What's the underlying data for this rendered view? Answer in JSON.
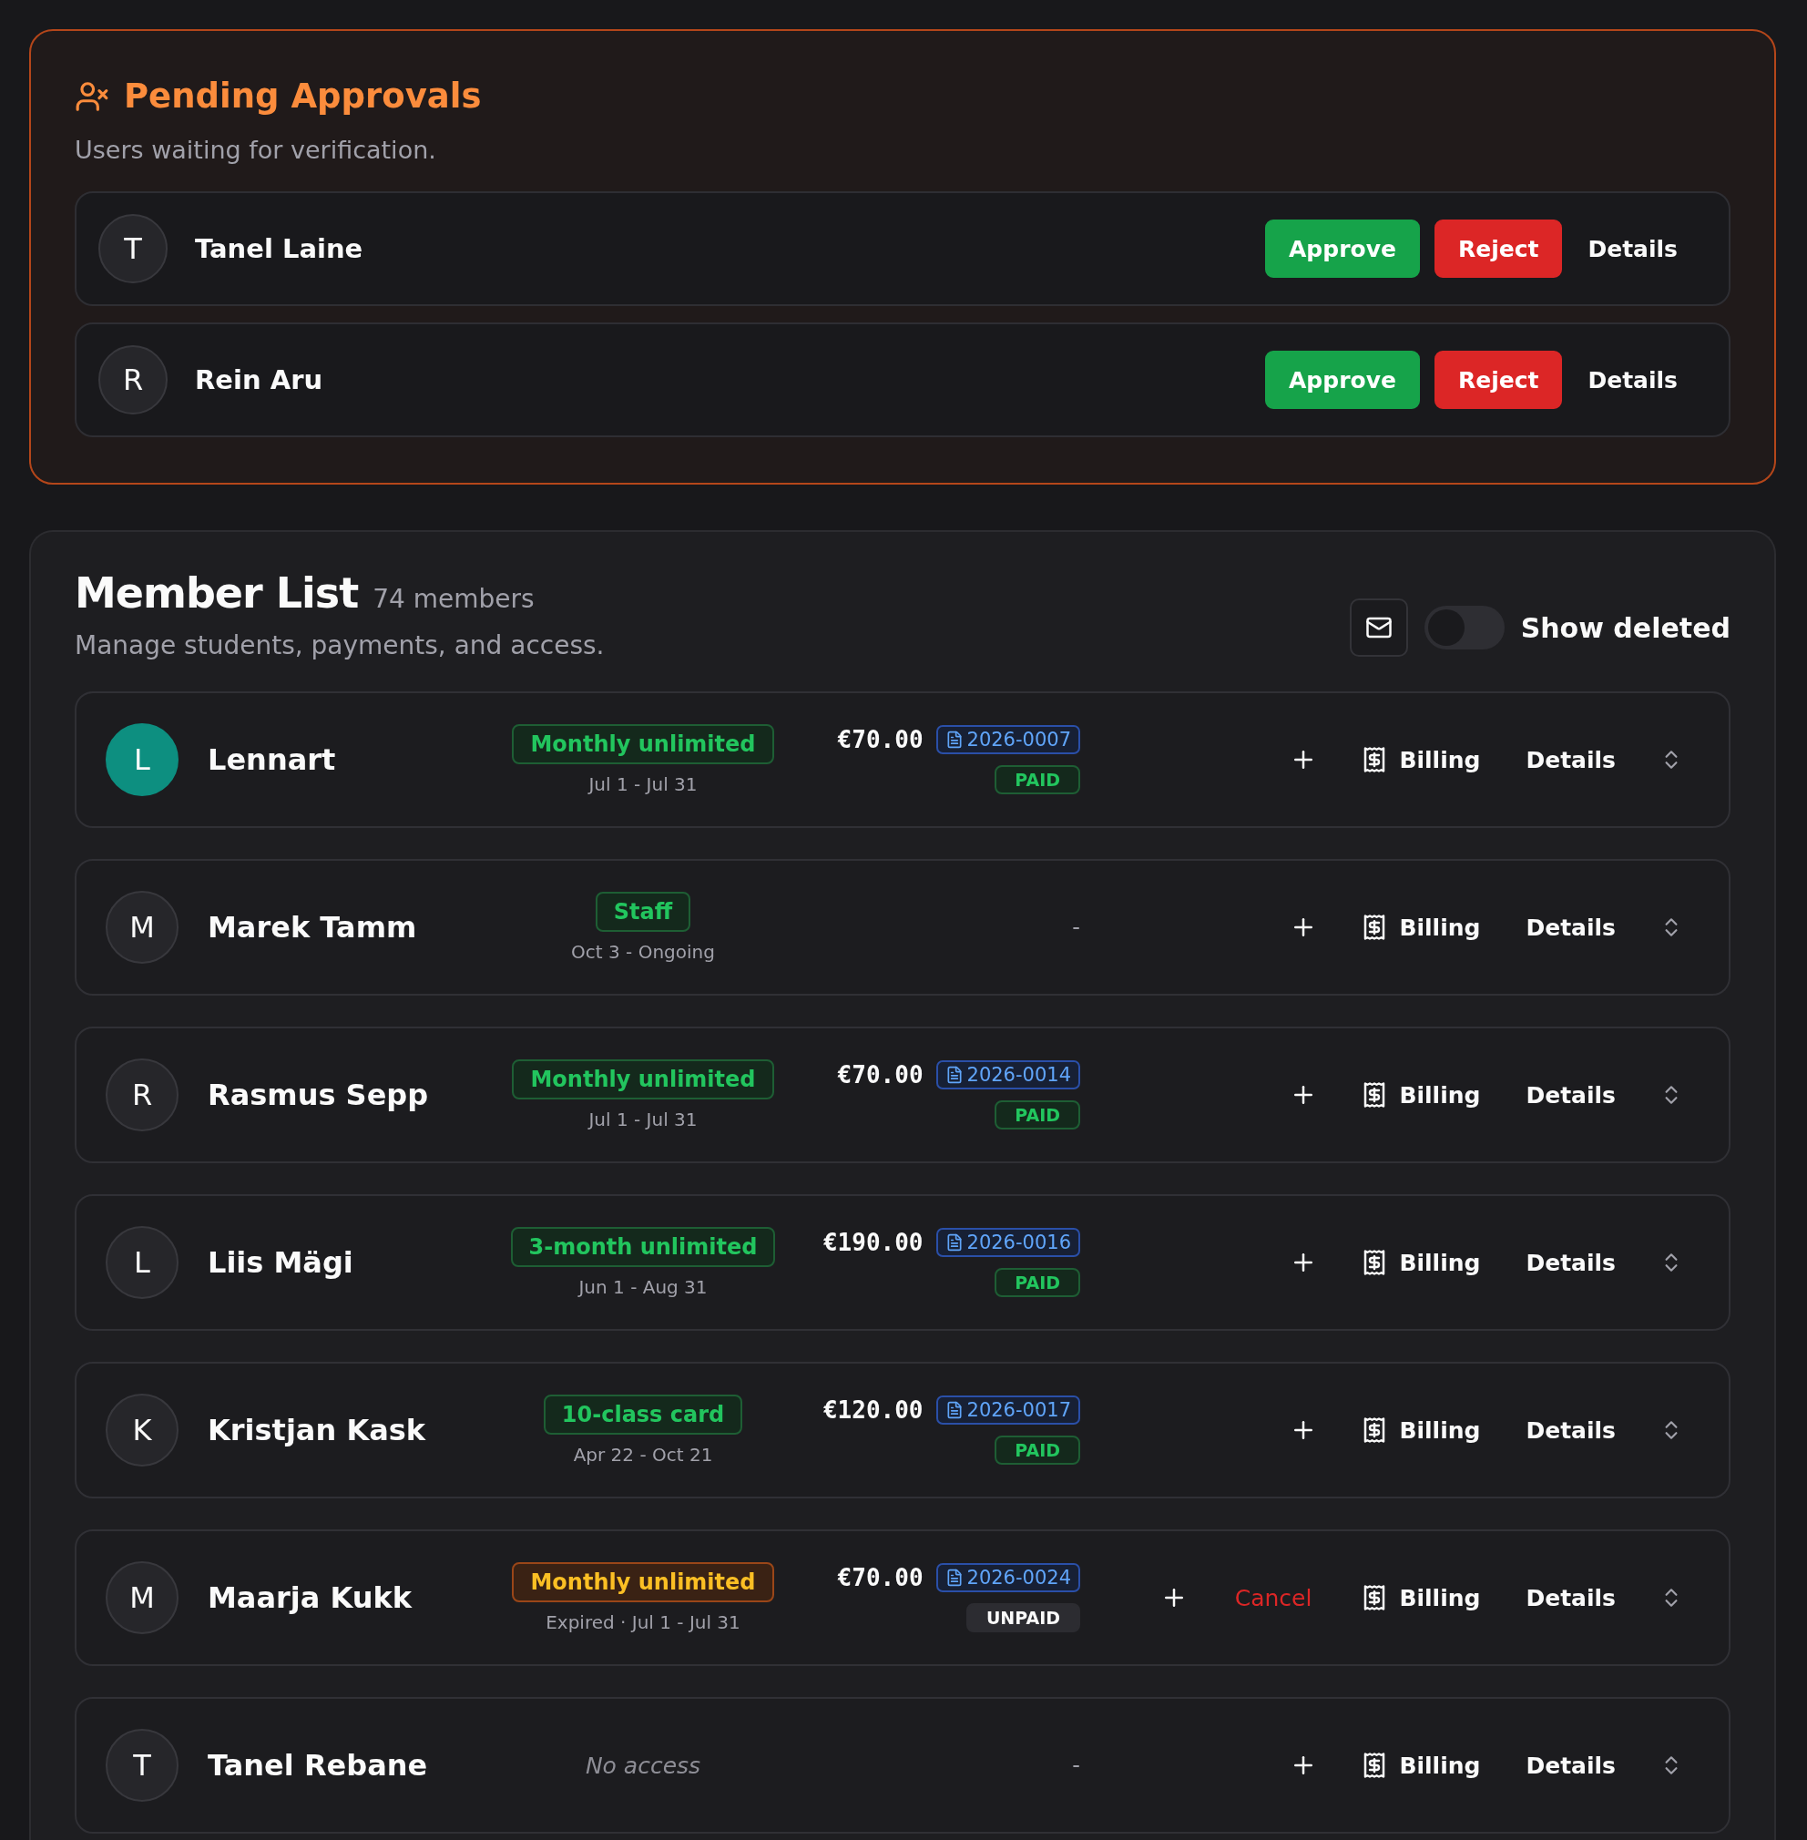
{
  "pending": {
    "title": "Pending Approvals",
    "subtitle": "Users waiting for verification.",
    "users": [
      {
        "initial": "T",
        "name": "Tanel Laine",
        "approve": "Approve",
        "reject": "Reject",
        "details": "Details"
      },
      {
        "initial": "R",
        "name": "Rein Aru",
        "approve": "Approve",
        "reject": "Reject",
        "details": "Details"
      }
    ]
  },
  "members": {
    "title": "Member List",
    "count": "74 members",
    "subtitle": "Manage students, payments, and access.",
    "show_deleted": {
      "label": "Show deleted",
      "on": false
    },
    "rows": [
      {
        "initial": "L",
        "name": "Lennart",
        "highlighted": true,
        "plan": {
          "kind": "badge",
          "label": "Monthly unlimited",
          "expired": false,
          "period": "Jul 1 - Jul 31"
        },
        "payment": {
          "kind": "invoice",
          "amount": "€70.00",
          "invoice": "2026-0007",
          "paid": true,
          "status_label": "PAID"
        },
        "billing": "Billing",
        "details": "Details"
      },
      {
        "initial": "M",
        "name": "Marek Tamm",
        "highlighted": false,
        "plan": {
          "kind": "badge",
          "label": "Staff",
          "expired": false,
          "period": "Oct 3 - Ongoing"
        },
        "payment": {
          "kind": "none",
          "text": "-"
        },
        "billing": "Billing",
        "details": "Details"
      },
      {
        "initial": "R",
        "name": "Rasmus Sepp",
        "highlighted": false,
        "plan": {
          "kind": "badge",
          "label": "Monthly unlimited",
          "expired": false,
          "period": "Jul 1 - Jul 31"
        },
        "payment": {
          "kind": "invoice",
          "amount": "€70.00",
          "invoice": "2026-0014",
          "paid": true,
          "status_label": "PAID"
        },
        "billing": "Billing",
        "details": "Details"
      },
      {
        "initial": "L",
        "name": "Liis Mägi",
        "highlighted": false,
        "plan": {
          "kind": "badge",
          "label": "3-month unlimited",
          "expired": false,
          "period": "Jun 1 - Aug 31"
        },
        "payment": {
          "kind": "invoice",
          "amount": "€190.00",
          "invoice": "2026-0016",
          "paid": true,
          "status_label": "PAID"
        },
        "billing": "Billing",
        "details": "Details"
      },
      {
        "initial": "K",
        "name": "Kristjan Kask",
        "highlighted": false,
        "plan": {
          "kind": "badge",
          "label": "10-class card",
          "expired": false,
          "period": "Apr 22 - Oct 21"
        },
        "payment": {
          "kind": "invoice",
          "amount": "€120.00",
          "invoice": "2026-0017",
          "paid": true,
          "status_label": "PAID"
        },
        "billing": "Billing",
        "details": "Details"
      },
      {
        "initial": "M",
        "name": "Maarja Kukk",
        "highlighted": false,
        "plan": {
          "kind": "badge",
          "label": "Monthly unlimited",
          "expired": true,
          "period": "Expired · Jul 1 - Jul 31"
        },
        "payment": {
          "kind": "invoice",
          "amount": "€70.00",
          "invoice": "2026-0024",
          "paid": false,
          "status_label": "UNPAID"
        },
        "cancel": "Cancel",
        "billing": "Billing",
        "details": "Details"
      },
      {
        "initial": "T",
        "name": "Tanel Rebane",
        "highlighted": false,
        "plan": {
          "kind": "none",
          "label": "No access"
        },
        "payment": {
          "kind": "none",
          "text": "-"
        },
        "billing": "Billing",
        "details": "Details"
      }
    ]
  }
}
